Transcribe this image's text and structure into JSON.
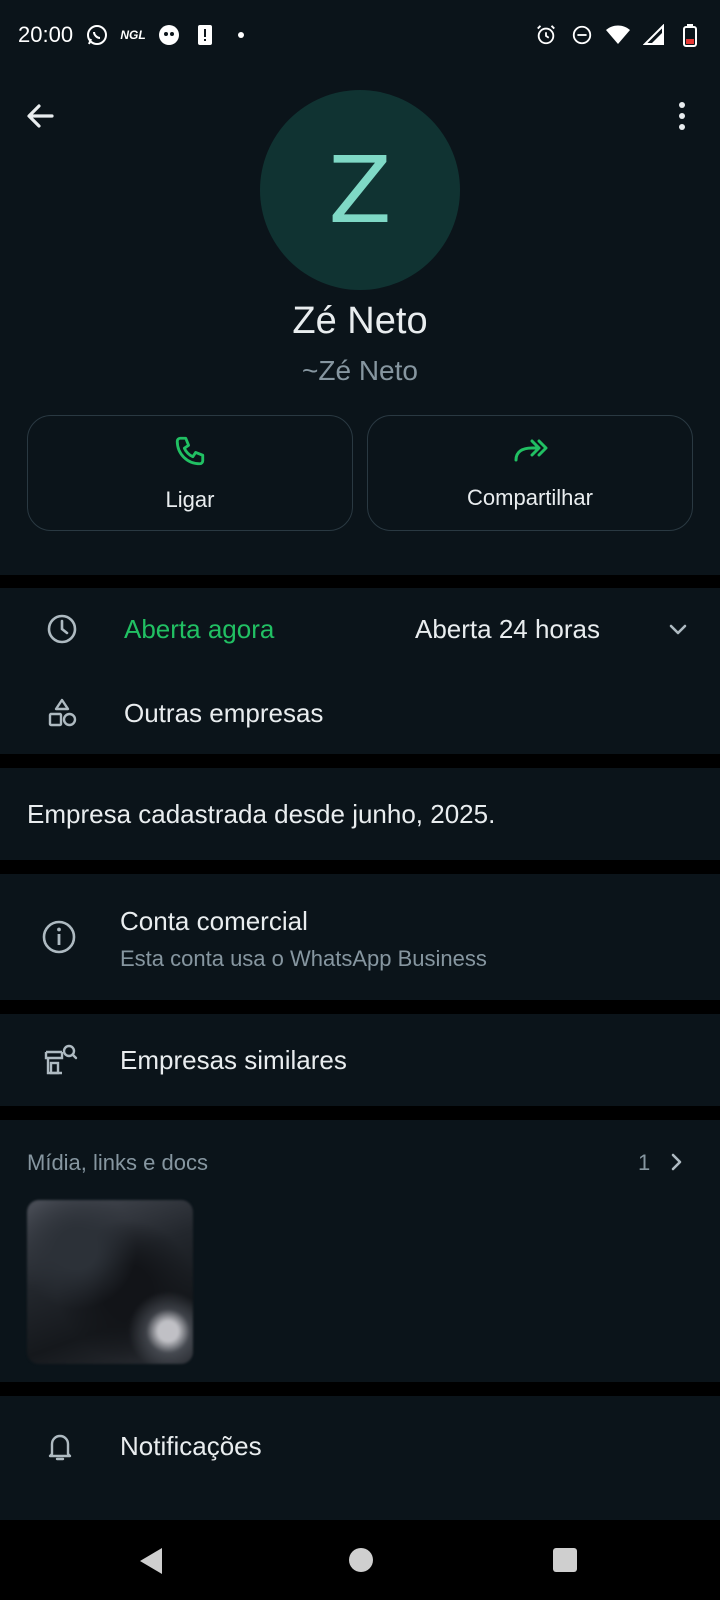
{
  "status_bar": {
    "time": "20:00",
    "notification_icons": [
      "whatsapp-icon",
      "ngl-icon",
      "app-icon",
      "alert-icon",
      "dot-icon"
    ],
    "ngl_label": "NGL",
    "right_icons": [
      "alarm-icon",
      "dnd-icon",
      "wifi-icon",
      "signal-icon",
      "battery-icon"
    ]
  },
  "profile": {
    "avatar_letter": "Z",
    "name": "Zé Neto",
    "push_name": "~Zé Neto"
  },
  "actions": {
    "call_label": "Ligar",
    "share_label": "Compartilhar"
  },
  "business_hours": {
    "status": "Aberta agora",
    "hours": "Aberta 24 horas"
  },
  "other_businesses": {
    "label": "Outras empresas"
  },
  "registered_since": {
    "text": "Empresa cadastrada desde junho, 2025."
  },
  "business_account": {
    "title": "Conta comercial",
    "subtitle": "Esta conta usa o WhatsApp Business"
  },
  "similar_businesses": {
    "label": "Empresas similares"
  },
  "media": {
    "title": "Mídia, links e docs",
    "count": "1"
  },
  "notifications": {
    "label": "Notificações"
  },
  "colors": {
    "background": "#0b141a",
    "accent_green": "#21c063",
    "avatar_bg": "#103332",
    "avatar_letter": "#7fd9c6"
  }
}
